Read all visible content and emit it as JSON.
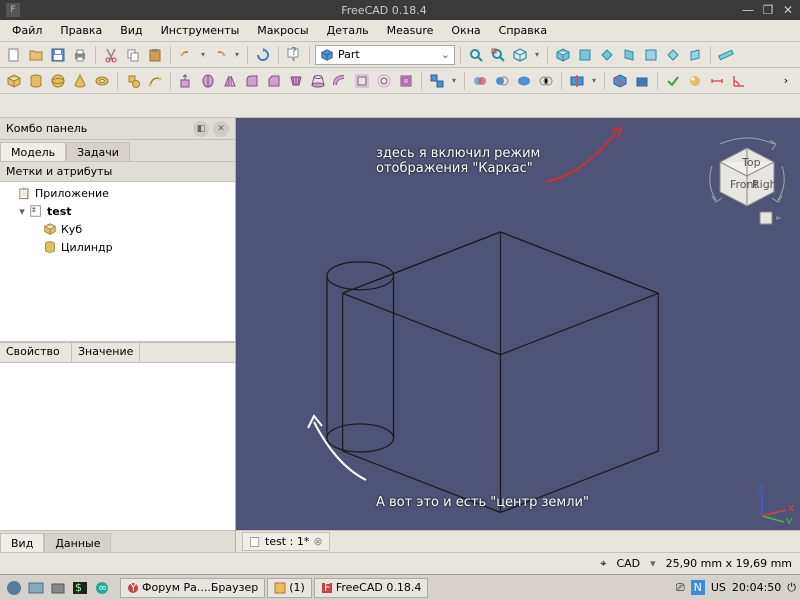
{
  "title": "FreeCAD 0.18.4",
  "menu": [
    "Файл",
    "Правка",
    "Вид",
    "Инструменты",
    "Макросы",
    "Деталь",
    "Measure",
    "Окна",
    "Справка"
  ],
  "workbench": "Part",
  "combo": {
    "title": "Комбо панель",
    "tabs": [
      "Модель",
      "Задачи"
    ],
    "section": "Метки и атрибуты",
    "tree": {
      "app": "Приложение",
      "doc": "test",
      "items": [
        "Куб",
        "Цилиндр"
      ]
    },
    "props": {
      "col1": "Свойство",
      "col2": "Значение"
    },
    "bottom_tabs": [
      "Вид",
      "Данные"
    ]
  },
  "annotations": {
    "top": "здесь я включил режим отображения \"Каркас\"",
    "bottom": "А вот это и есть \"центр земли\""
  },
  "navcube": {
    "front": "Front",
    "right": "Right",
    "top": "Top"
  },
  "doc_tab": "test : 1*",
  "status": {
    "mode": "CAD",
    "coords": "25,90 mm x 19,69 mm"
  },
  "taskbar": {
    "app1": "Форум Ра....Браузер",
    "app2": "(1)",
    "app3": "FreeCAD 0.18.4",
    "lang": "US",
    "time": "20:04:50"
  }
}
